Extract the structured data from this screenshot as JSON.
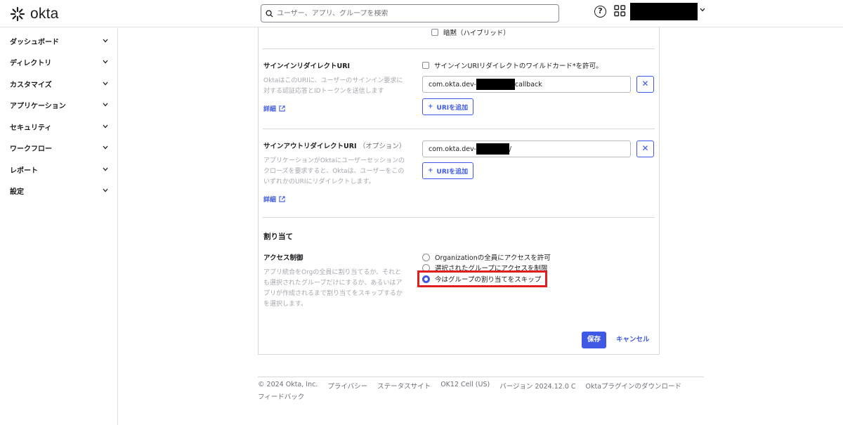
{
  "header": {
    "logo_text": "okta",
    "search_placeholder": "ユーザー、アプリ、グループを検索",
    "help": "?"
  },
  "sidebar": {
    "items": [
      {
        "label": "ダッシュボード"
      },
      {
        "label": "ディレクトリ"
      },
      {
        "label": "カスタマイズ"
      },
      {
        "label": "アプリケーション"
      },
      {
        "label": "セキュリティ"
      },
      {
        "label": "ワークフロー"
      },
      {
        "label": "レポート"
      },
      {
        "label": "設定"
      }
    ]
  },
  "form": {
    "top_option": "暗黙（ハイブリッド）",
    "signin": {
      "label": "サインインリダイレクトURI",
      "wildcard_label": "サインインURIリダイレクトのワイルドカード*を許可。",
      "description": "OktaはこのURIに、ユーザーのサインイン要求に対する認証応答とIDトークンを送信します",
      "details_link": "詳細",
      "uri_prefix": "com.okta.dev-",
      "uri_suffix": "callback",
      "add_button": "URIを追加"
    },
    "signout": {
      "label": "サインアウトリダイレクトURI",
      "optional": "（オプション）",
      "description": "アプリケーションがOktaにユーザーセッションのクローズを要求すると、Oktaは、ユーザーをこのいずれかのURIにリダイレクトします。",
      "details_link": "詳細",
      "uri_prefix": "com.okta.dev-",
      "uri_suffix": "/",
      "add_button": "URIを追加"
    },
    "assignment": {
      "section_title": "割り当て",
      "label": "アクセス制御",
      "description": "アプリ統合をOrgの全員に割り当てるか、それとも選択されたグループだけにするか、あるいはアプリが作成されるまで割り当てをスキップするかを選択します。",
      "options": [
        {
          "label": "Organizationの全員にアクセスを許可",
          "selected": false
        },
        {
          "label": "選択されたグループにアクセスを制限",
          "selected": false
        },
        {
          "label": "今はグループの割り当てをスキップ",
          "selected": true
        }
      ]
    },
    "save_button": "保存",
    "cancel_button": "キャンセル"
  },
  "footer": {
    "items": [
      "© 2024 Okta, Inc.",
      "プライバシー",
      "ステータスサイト",
      "OK12 Cell (US)",
      "バージョン 2024.12.0 C",
      "Oktaプラグインのダウンロード"
    ],
    "feedback": "フィードバック"
  },
  "colors": {
    "accent": "#3f59e4",
    "highlight": "#e11e1e"
  }
}
